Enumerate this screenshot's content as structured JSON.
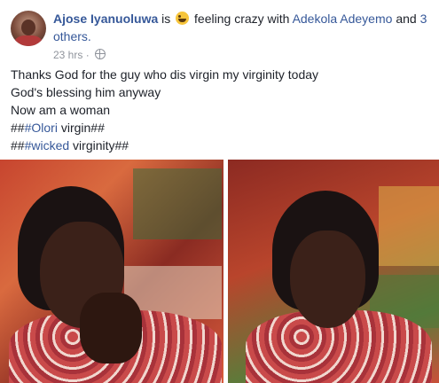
{
  "post": {
    "author": "Ajose Iyanuoluwa",
    "is": "is",
    "feeling": "feeling crazy with",
    "tagged": "Adekola Adeyemo",
    "and": "and",
    "others": "3 others.",
    "time": "23 hrs",
    "separator": "·",
    "lines": {
      "l1": "Thanks God for the guy who dis virgin my virginity today",
      "l2": "God's blessing him anyway",
      "l3": "Now am a woman",
      "l4_prefix": "##",
      "l4_tag": "#Olori",
      "l4_suffix": " virgin##",
      "l5_prefix": "##",
      "l5_tag": "#wicked",
      "l5_suffix": " virginity##"
    },
    "icons": {
      "avatar": "avatar",
      "emoji": "laughing-emoji-icon",
      "privacy": "globe-icon"
    }
  }
}
